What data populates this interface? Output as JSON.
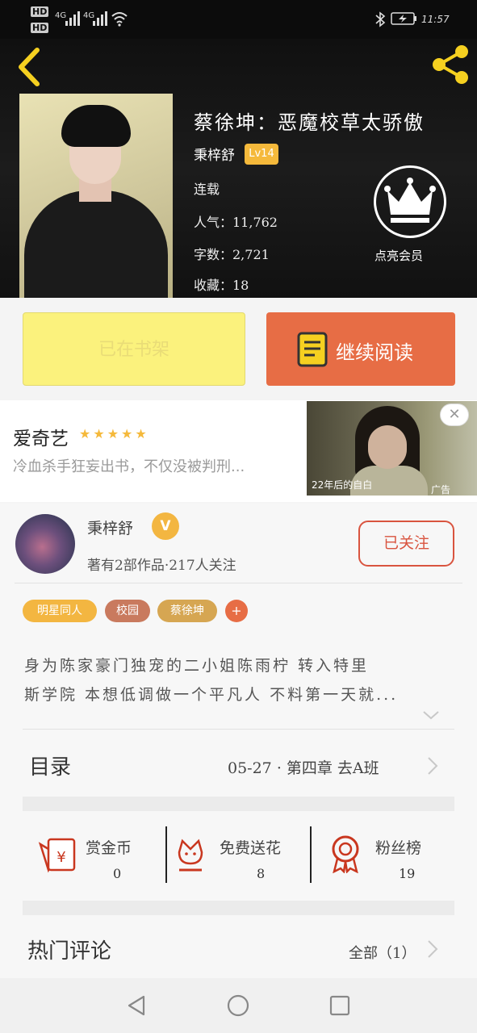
{
  "status_bar": {
    "time": "11:57",
    "network1": "4G",
    "network2": "4G",
    "hd1": "HD",
    "hd2": "HD"
  },
  "book": {
    "title": "蔡徐坤：恶魔校草太骄傲",
    "author": "秉梓舒",
    "level": "Lv14",
    "status": "连载",
    "popularity": "人气：11,762",
    "word_count": "字数：2,721",
    "favorites": "收藏：18",
    "premium_label": "点亮会员"
  },
  "actions": {
    "add_shelf": "已在书架",
    "continue_reading": "继续阅读"
  },
  "ad": {
    "title": "爱奇艺",
    "stars": "★★★★★",
    "description": "冷血杀手狂妄出书，不仅没被判刑...",
    "close": "✕",
    "caption": "22年后的自白",
    "label": "广告"
  },
  "author_panel": {
    "name": "秉梓舒",
    "verified": "V",
    "stats": "著有2部作品·217人关注",
    "follow_label": "已关注"
  },
  "tags": [
    "明星同人",
    "校园",
    "蔡徐坤",
    "+"
  ],
  "intro": [
    "身为陈家豪门独宠的二小姐陈雨柠 转入特里",
    "斯学院 本想低调做一个平凡人 不料第一天就..."
  ],
  "toc": {
    "label": "目录",
    "latest": "05-27 · 第四章 去A班"
  },
  "gifts": [
    {
      "label": "赏金币",
      "count": "0"
    },
    {
      "label": "免费送花",
      "count": "8"
    },
    {
      "label": "粉丝榜",
      "count": "19"
    }
  ],
  "comments": {
    "label": "热门评论",
    "all": "全部（1）"
  },
  "colors": {
    "accent_yellow": "#f5d020",
    "orange": "#e76d45",
    "red": "#d9543f",
    "badge": "#f5b93b"
  }
}
